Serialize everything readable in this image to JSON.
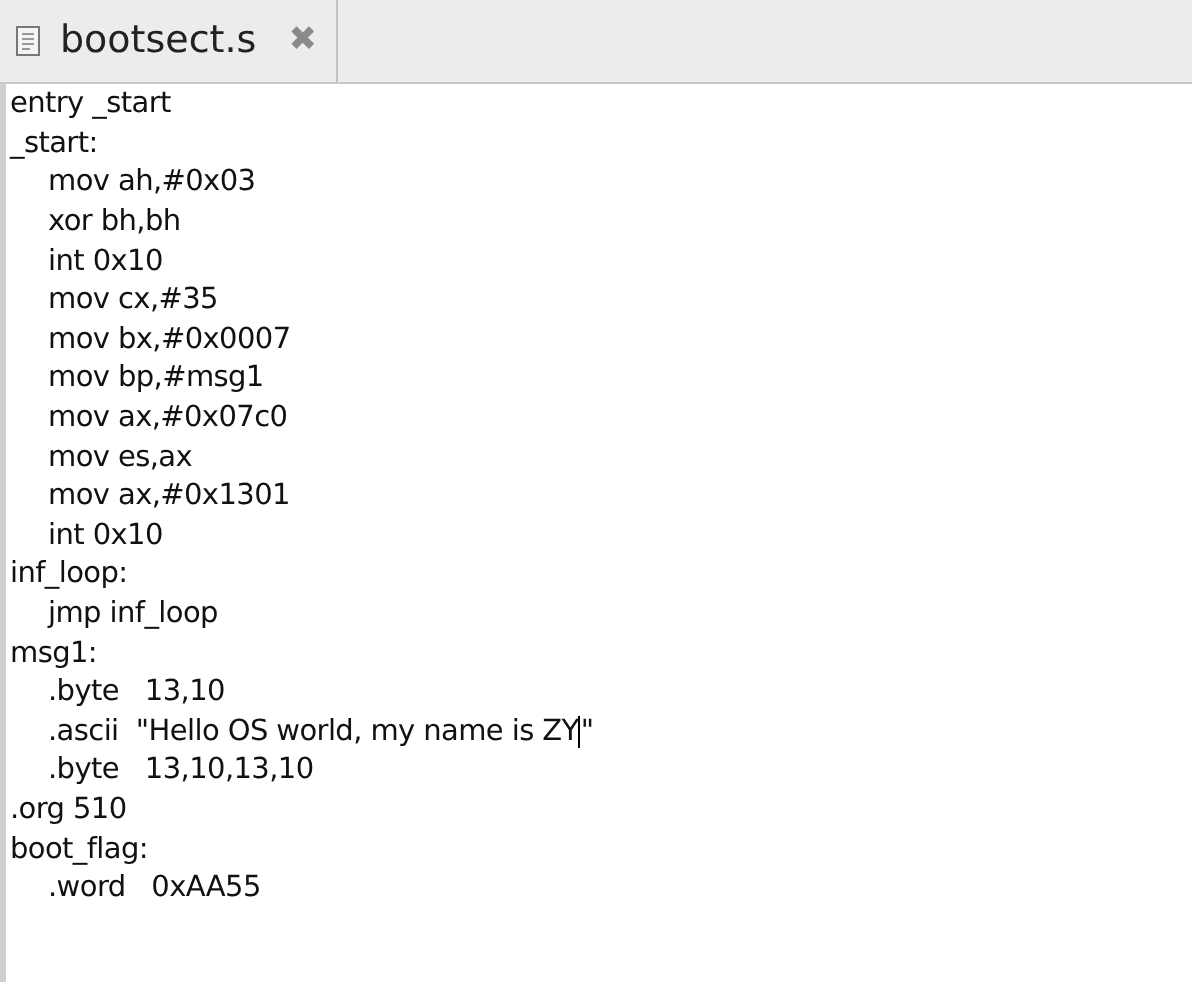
{
  "tab": {
    "title": "bootsect.s",
    "close": "✖"
  },
  "lines": [
    {
      "text": "entry _start"
    },
    {
      "text": "_start:",
      "children": [
        {
          "text": "mov ah,#0x03"
        },
        {
          "text": "xor bh,bh"
        },
        {
          "text": "int 0x10"
        },
        {
          "text": "mov cx,#35"
        },
        {
          "text": "mov bx,#0x0007"
        },
        {
          "text": "mov bp,#msg1"
        },
        {
          "text": "mov ax,#0x07c0"
        },
        {
          "text": "mov es,ax"
        },
        {
          "text": "mov ax,#0x1301"
        },
        {
          "text": "int 0x10"
        }
      ]
    },
    {
      "text": "inf_loop:",
      "children": [
        {
          "text": "jmp inf_loop"
        }
      ]
    },
    {
      "text": "msg1:",
      "children": [
        {
          "text": ".byte   13,10"
        },
        {
          "text": ".ascii  \"Hello OS world, my name is ZY",
          "text_after_caret": "\""
        },
        {
          "text": ".byte   13,10,13,10"
        }
      ]
    },
    {
      "text": ".org 510"
    },
    {
      "text": "boot_flag:",
      "children": [
        {
          "text": ".word   0xAA55"
        }
      ]
    }
  ]
}
